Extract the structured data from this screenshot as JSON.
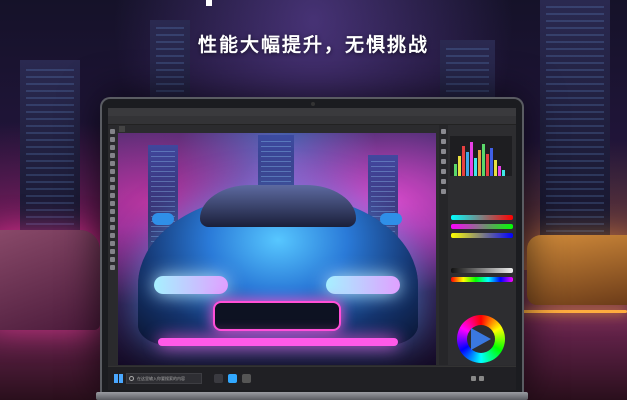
{
  "headline": "性能大幅提升，无惧挑战",
  "app": {
    "doc_tab": "",
    "menu": [
      "",
      "",
      "",
      "",
      "",
      "",
      "",
      "",
      "",
      "",
      ""
    ]
  },
  "taskbar": {
    "search_placeholder": "在这里输入你要搜索的内容",
    "clock_time": "",
    "clock_date": ""
  },
  "colors": {
    "accent_blue": "#4aa8ff",
    "neon_pink": "#ff4fd8",
    "car_blue": "#2a7ad8"
  },
  "icons": [
    "windows-start-icon",
    "search-icon",
    "photoshop-icon",
    "color-wheel-icon"
  ]
}
